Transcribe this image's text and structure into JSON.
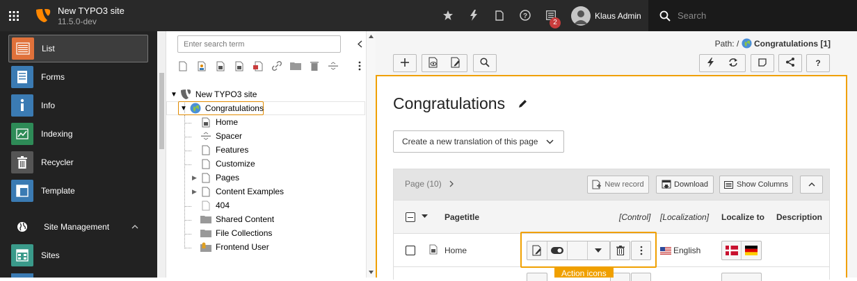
{
  "topbar": {
    "site_name": "New TYPO3 site",
    "site_version": "11.5.0-dev",
    "notification_count": "2",
    "user_name": "Klaus Admin",
    "search_placeholder": "Search",
    "brand_color": "#ff8700"
  },
  "modules": {
    "items": [
      {
        "label": "List",
        "icon": "list-icon",
        "color": "#e0713a"
      },
      {
        "label": "Forms",
        "icon": "forms-icon",
        "color": "#3b7bb3"
      },
      {
        "label": "Info",
        "icon": "info-icon",
        "color": "#3b7bb3"
      },
      {
        "label": "Indexing",
        "icon": "indexing-icon",
        "color": "#2e8b57"
      },
      {
        "label": "Recycler",
        "icon": "recycler-icon",
        "color": "#555555"
      },
      {
        "label": "Template",
        "icon": "template-icon",
        "color": "#3b7bb3"
      }
    ],
    "section": "Site Management",
    "sites": "Sites"
  },
  "tree": {
    "search_placeholder": "Enter search term",
    "root": "New TYPO3 site",
    "selected": "Congratulations",
    "children": [
      "Home",
      "Spacer",
      "Features",
      "Customize",
      "Pages",
      "Content Examples",
      "404",
      "Shared Content",
      "File Collections",
      "Frontend User"
    ]
  },
  "main": {
    "path_label": "Path: /",
    "path_page": "Congratulations [1]",
    "title": "Congratulations",
    "translation_select": "Create a new translation of this page",
    "table": {
      "header": "Page (10)",
      "new_record": "New record",
      "download": "Download",
      "show_columns": "Show Columns",
      "columns": {
        "pagetitle": "Pagetitle",
        "control": "[Control]",
        "localization": "[Localization]",
        "localize_to": "Localize to",
        "description": "Description"
      },
      "rows": [
        {
          "title": "Home",
          "language": "English"
        }
      ]
    },
    "tooltip": "Action icons",
    "highlight_color": "#f0a000"
  }
}
